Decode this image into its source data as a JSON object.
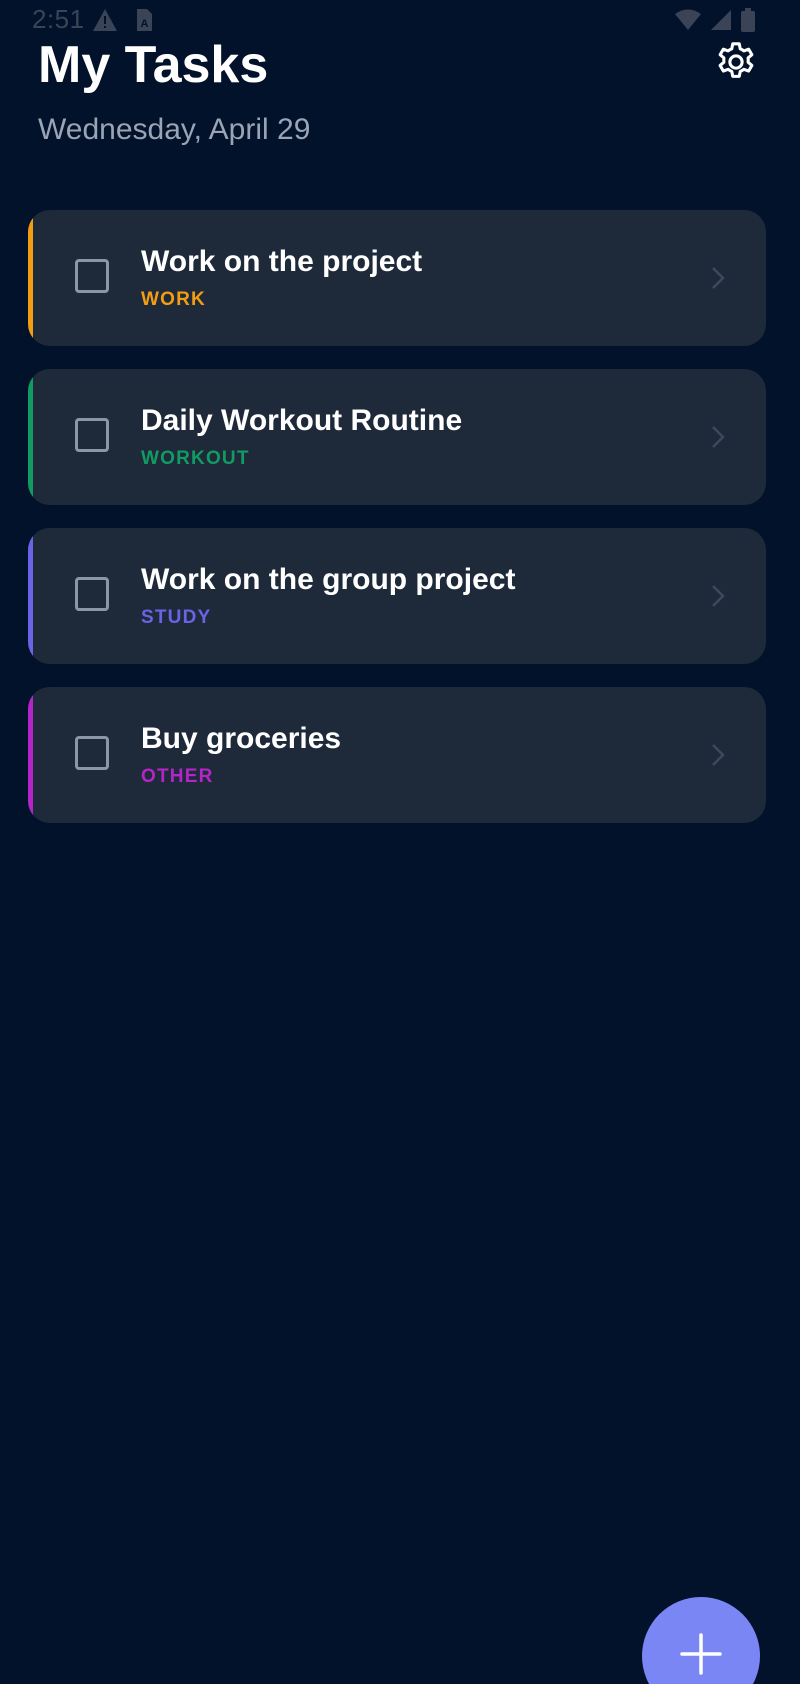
{
  "status_bar": {
    "time": "2:51"
  },
  "header": {
    "title": "My Tasks",
    "date": "Wednesday, April 29",
    "settings_icon": "gear-icon"
  },
  "tasks": [
    {
      "title": "Work on the project",
      "category": "WORK",
      "color": "#f29d12",
      "completed": false
    },
    {
      "title": "Daily Workout Routine",
      "category": "WORKOUT",
      "color": "#129a63",
      "completed": false
    },
    {
      "title": "Work on the group project",
      "category": "STUDY",
      "color": "#6a63e6",
      "completed": false
    },
    {
      "title": "Buy groceries",
      "category": "OTHER",
      "color": "#b425c9",
      "completed": false
    }
  ],
  "fab": {
    "icon": "plus-icon",
    "color": "#7b86f5"
  },
  "colors": {
    "background": "#02122a",
    "card": "#1e2a3a",
    "subtitle": "#9aa4b4"
  }
}
